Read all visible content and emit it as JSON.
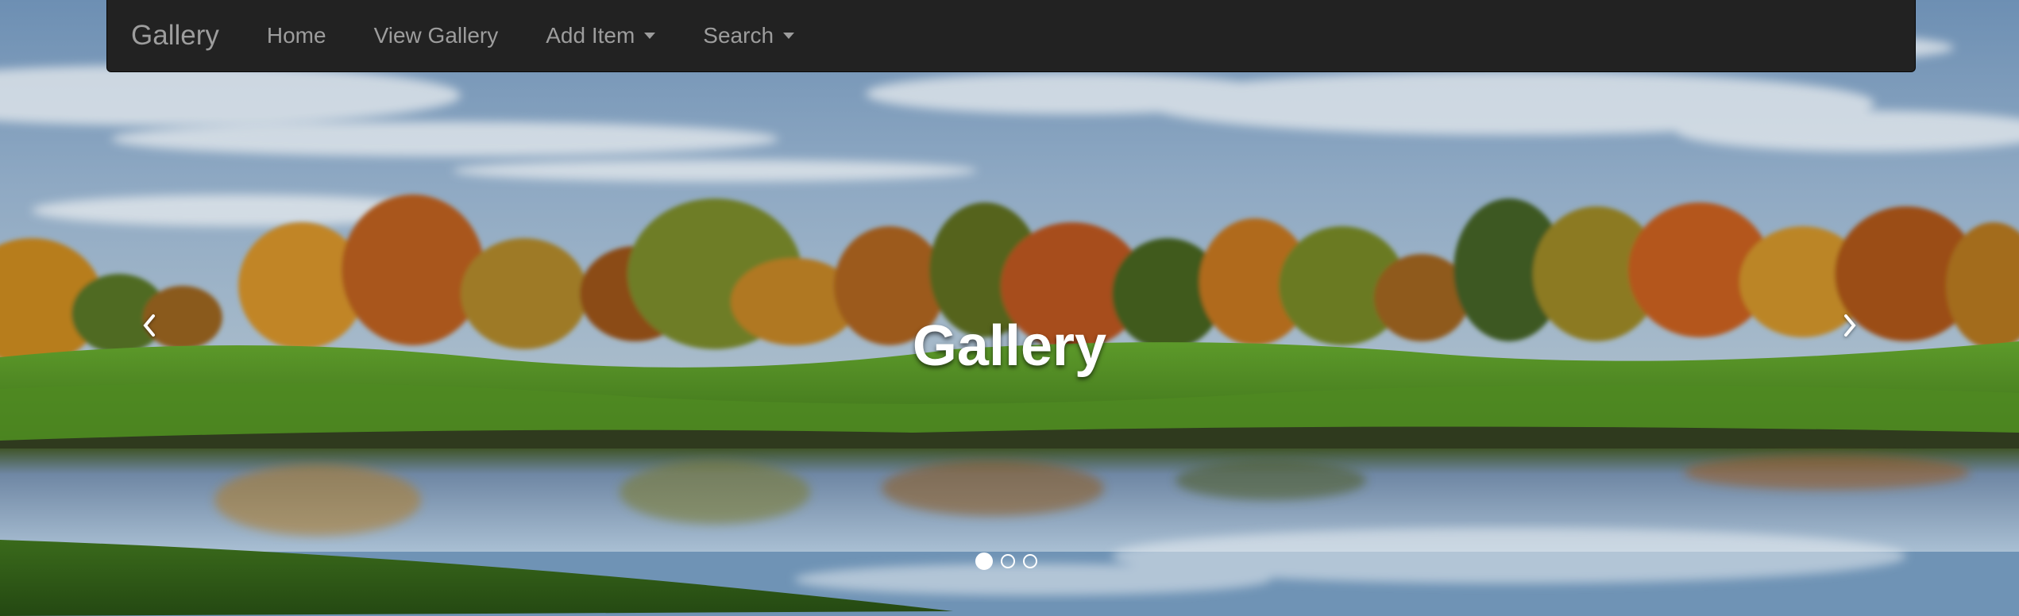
{
  "navbar": {
    "brand": "Gallery",
    "items": [
      {
        "label": "Home",
        "dropdown": false
      },
      {
        "label": "View Gallery",
        "dropdown": false
      },
      {
        "label": "Add Item",
        "dropdown": true
      },
      {
        "label": "Search",
        "dropdown": true
      }
    ]
  },
  "carousel": {
    "caption": "Gallery",
    "slide_count": 3,
    "active_slide": 1,
    "controls": {
      "prev_icon": "chevron-left-icon",
      "next_icon": "chevron-right-icon"
    }
  },
  "colors": {
    "navbar_bg": "#222222",
    "nav_text": "#9d9d9d",
    "caption_text": "#ffffff"
  }
}
